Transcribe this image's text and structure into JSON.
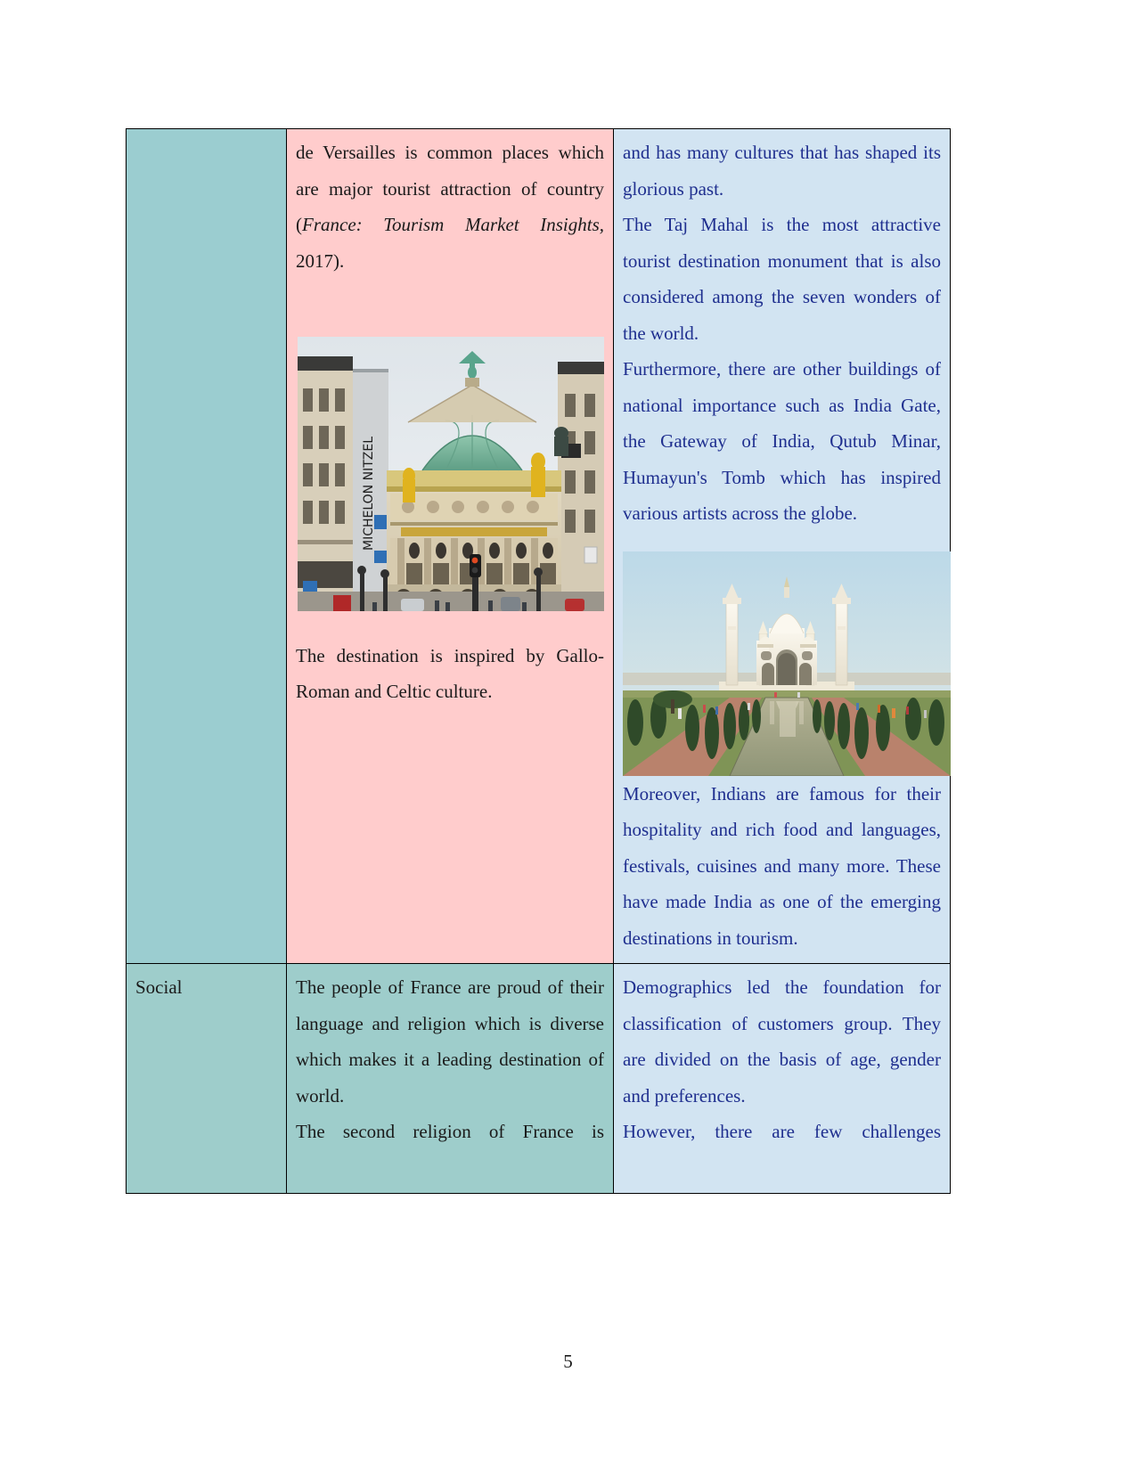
{
  "page": {
    "number": "5"
  },
  "table": {
    "rows": [
      {
        "label": "",
        "france": {
          "paragraphs": [
            {
              "segments": [
                {
                  "text": "de Versailles is common places which are major tourist attraction of country (",
                  "style": "normal"
                },
                {
                  "text": "France: Tourism Market Insights,",
                  "style": "italic"
                },
                {
                  "text": " 2017).",
                  "style": "normal"
                }
              ]
            }
          ],
          "image": {
            "name": "paris-opera-house-photo",
            "caption": "Palais Garnier opera house in Paris with green dome, golden statues and street view"
          },
          "paragraphs_after": [
            "The destination is inspired by Gallo-Roman and Celtic culture."
          ]
        },
        "india": {
          "paragraphs": [
            "and has many cultures that has shaped its glorious past.",
            "The Taj Mahal is the most attractive tourist destination monument that is also considered among the seven wonders of the world.",
            "Furthermore, there are other buildings of national importance such as India Gate, the Gateway of India, Qutub Minar, Humayun's Tomb which has inspired various artists across the globe."
          ],
          "image": {
            "name": "taj-mahal-photo",
            "caption": "Taj Mahal with reflecting pool, cypress trees and four minarets"
          },
          "paragraphs_after": [
            "Moreover, Indians are famous for their hospitality and rich food and languages, festivals, cuisines and many more. These have made India as one of the emerging destinations in tourism."
          ]
        }
      },
      {
        "label": "Social",
        "france": {
          "paragraphs": [
            "The people of France are proud of their language and religion which is diverse which makes it a leading destination of world.",
            "The second religion of France is"
          ]
        },
        "india": {
          "paragraphs": [
            "Demographics led the foundation for classification of customers group. They are divided on the basis of age, gender and preferences.",
            "However, there are few challenges"
          ]
        }
      }
    ]
  },
  "colors": {
    "teal": "#9bcdd0",
    "pink": "#ffcccc",
    "light_blue": "#d2e4f2",
    "blue_text": "#1f2f8f",
    "border": "#000000"
  }
}
